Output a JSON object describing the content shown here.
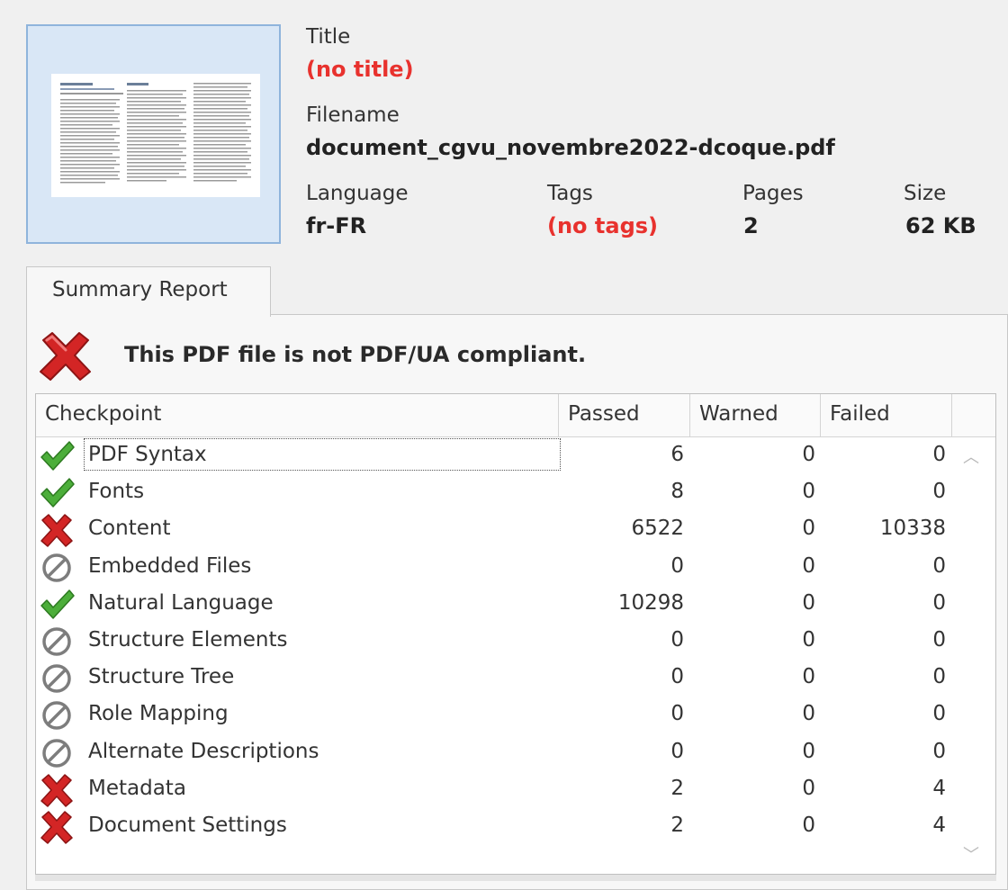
{
  "document": {
    "title_label": "Title",
    "title_value": "(no title)",
    "filename_label": "Filename",
    "filename_value": "document_cgvu_novembre2022-dcoque.pdf",
    "language_label": "Language",
    "language_value": "fr-FR",
    "tags_label": "Tags",
    "tags_value": "(no tags)",
    "pages_label": "Pages",
    "pages_value": "2",
    "size_label": "Size",
    "size_value": "62 KB"
  },
  "tab": {
    "label": "Summary Report"
  },
  "status": {
    "icon": "red-x-icon",
    "message": "This PDF file is not PDF/UA compliant."
  },
  "table": {
    "headers": {
      "checkpoint": "Checkpoint",
      "passed": "Passed",
      "warned": "Warned",
      "failed": "Failed"
    },
    "rows": [
      {
        "icon": "check-icon",
        "name": "PDF Syntax",
        "passed": "6",
        "warned": "0",
        "failed": "0"
      },
      {
        "icon": "check-icon",
        "name": "Fonts",
        "passed": "8",
        "warned": "0",
        "failed": "0"
      },
      {
        "icon": "red-x-icon",
        "name": "Content",
        "passed": "6522",
        "warned": "0",
        "failed": "10338"
      },
      {
        "icon": "not-applicable-icon",
        "name": "Embedded Files",
        "passed": "0",
        "warned": "0",
        "failed": "0"
      },
      {
        "icon": "check-icon",
        "name": "Natural Language",
        "passed": "10298",
        "warned": "0",
        "failed": "0"
      },
      {
        "icon": "not-applicable-icon",
        "name": "Structure Elements",
        "passed": "0",
        "warned": "0",
        "failed": "0"
      },
      {
        "icon": "not-applicable-icon",
        "name": "Structure Tree",
        "passed": "0",
        "warned": "0",
        "failed": "0"
      },
      {
        "icon": "not-applicable-icon",
        "name": "Role Mapping",
        "passed": "0",
        "warned": "0",
        "failed": "0"
      },
      {
        "icon": "not-applicable-icon",
        "name": "Alternate Descriptions",
        "passed": "0",
        "warned": "0",
        "failed": "0"
      },
      {
        "icon": "red-x-icon",
        "name": "Metadata",
        "passed": "2",
        "warned": "0",
        "failed": "4"
      },
      {
        "icon": "red-x-icon",
        "name": "Document Settings",
        "passed": "2",
        "warned": "0",
        "failed": "4"
      }
    ]
  },
  "colors": {
    "error_red": "#e8322e",
    "check_green": "#3a9a2a",
    "selection_blue": "#d9e7f6"
  }
}
